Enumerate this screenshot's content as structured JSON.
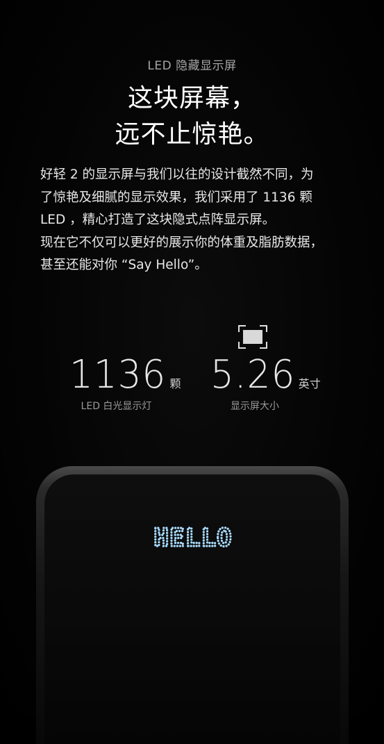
{
  "intro": {
    "eyebrow": "LED 隐藏显示屏",
    "headline_line1": "这块屏幕，",
    "headline_line2": "远不止惊艳。"
  },
  "description": {
    "lines": [
      "好轻 2 的显示屏与我们以往的设计截然不同，为",
      "了惊艳及细腻的显示效果，我们采用了 1136 颗",
      "LED ，精心打造了这块隐式点阵显示屏。",
      "现在它不仅可以更好的展示你的体重及脂肪数据，",
      "甚至还能对你 “Say Hello”。"
    ]
  },
  "stats": [
    {
      "value": "1136",
      "unit": "颗",
      "caption": "LED 白光显示灯"
    },
    {
      "value": "5.26",
      "unit": "英寸",
      "caption": "显示屏大小"
    }
  ],
  "icons": {
    "screen_size": "screen-size-icon"
  },
  "device": {
    "display_text": "HELLO",
    "led_color": "#a9dcff"
  },
  "colors": {
    "background": "#000000",
    "text_primary": "#ffffff",
    "text_secondary": "#9a9a9a"
  }
}
